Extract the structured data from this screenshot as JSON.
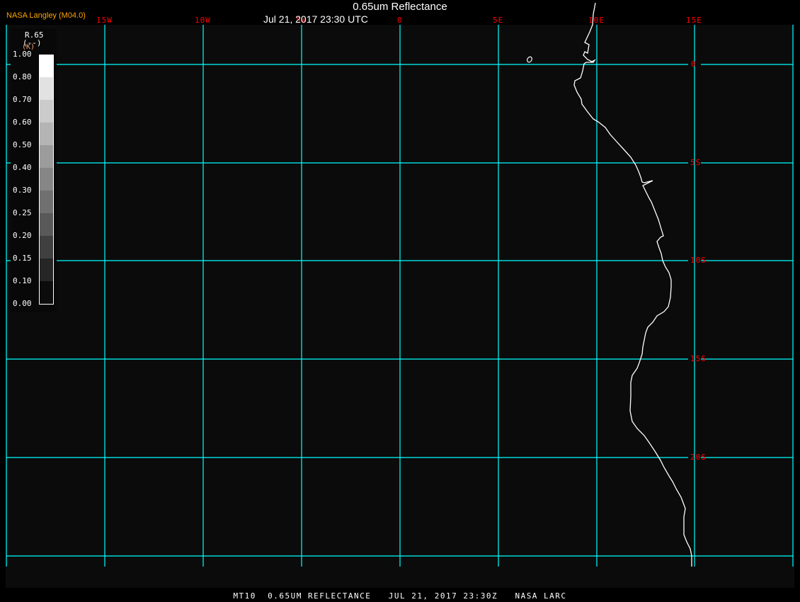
{
  "header": {
    "brand": "NASA Langley (M04.0)",
    "title": "0.65um Reflectance",
    "subtitle": "Jul 21, 2017 23:30 UTC"
  },
  "footer": {
    "caption": "MT10  0.65UM REFLECTANCE   JUL 21, 2017 23:30Z   NASA LARC"
  },
  "map": {
    "projection": "lat-lon grid",
    "grid_color": "#00ffff",
    "label_color": "#ff0000",
    "coastline_color": "#ffffff",
    "longitude_labels": [
      "15W",
      "10W",
      "5W",
      "0",
      "5E",
      "10E",
      "15E"
    ],
    "latitude_labels": [
      "0",
      "5S",
      "10S",
      "15S",
      "20S"
    ]
  },
  "legend": {
    "variable": "R.65",
    "units": "(--)",
    "units_alt": "(K)",
    "ticks": [
      "1.00",
      "0.80",
      "0.70",
      "0.60",
      "0.50",
      "0.40",
      "0.30",
      "0.25",
      "0.20",
      "0.15",
      "0.10",
      "0.00"
    ],
    "colors": [
      "#ffffff",
      "#e2e2e2",
      "#cbcbcb",
      "#b4b4b4",
      "#9c9c9c",
      "#868686",
      "#707070",
      "#595959",
      "#404040",
      "#262626",
      "#0c0c0c"
    ]
  }
}
